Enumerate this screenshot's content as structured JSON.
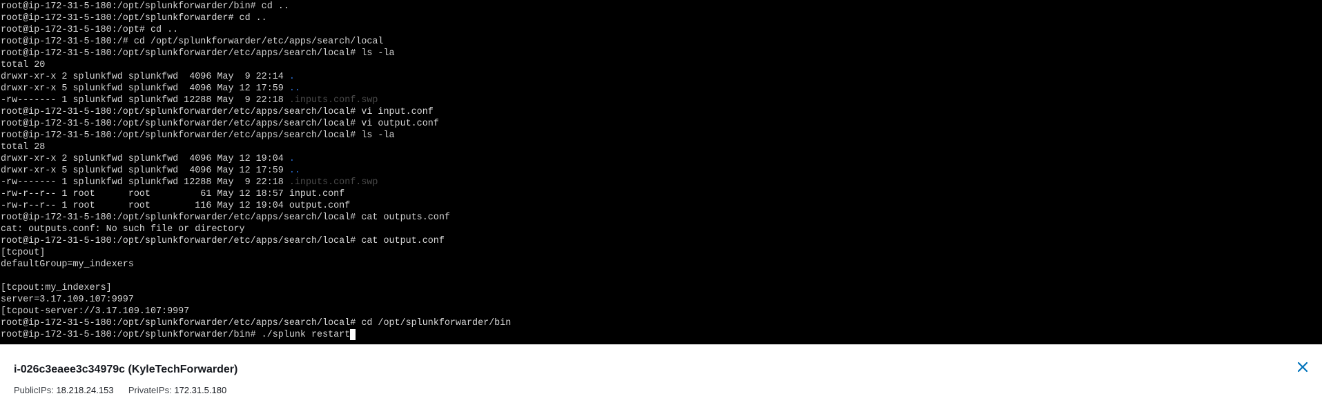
{
  "terminal": {
    "lines": [
      [
        {
          "t": "root@ip-172-31-5-180:/opt/splunkforwarder/bin# cd .."
        }
      ],
      [
        {
          "t": "root@ip-172-31-5-180:/opt/splunkforwarder# cd .."
        }
      ],
      [
        {
          "t": "root@ip-172-31-5-180:/opt# cd .."
        }
      ],
      [
        {
          "t": "root@ip-172-31-5-180:/# cd /opt/splunkforwarder/etc/apps/search/local"
        }
      ],
      [
        {
          "t": "root@ip-172-31-5-180:/opt/splunkforwarder/etc/apps/search/local# ls -la"
        }
      ],
      [
        {
          "t": "total 20"
        }
      ],
      [
        {
          "t": "drwxr-xr-x 2 splunkfwd splunkfwd  4096 May  9 22:14 "
        },
        {
          "t": ".",
          "c": "blue"
        }
      ],
      [
        {
          "t": "drwxr-xr-x 5 splunkfwd splunkfwd  4096 May 12 17:59 "
        },
        {
          "t": "..",
          "c": "blue"
        }
      ],
      [
        {
          "t": "-rw------- 1 splunkfwd splunkfwd 12288 May  9 22:18 "
        },
        {
          "t": ".inputs.conf.swp",
          "c": "dim"
        }
      ],
      [
        {
          "t": "root@ip-172-31-5-180:/opt/splunkforwarder/etc/apps/search/local# vi input.conf"
        }
      ],
      [
        {
          "t": "root@ip-172-31-5-180:/opt/splunkforwarder/etc/apps/search/local# vi output.conf"
        }
      ],
      [
        {
          "t": "root@ip-172-31-5-180:/opt/splunkforwarder/etc/apps/search/local# ls -la"
        }
      ],
      [
        {
          "t": "total 28"
        }
      ],
      [
        {
          "t": "drwxr-xr-x 2 splunkfwd splunkfwd  4096 May 12 19:04 "
        },
        {
          "t": ".",
          "c": "blue"
        }
      ],
      [
        {
          "t": "drwxr-xr-x 5 splunkfwd splunkfwd  4096 May 12 17:59 "
        },
        {
          "t": "..",
          "c": "blue"
        }
      ],
      [
        {
          "t": "-rw------- 1 splunkfwd splunkfwd 12288 May  9 22:18 "
        },
        {
          "t": ".inputs.conf.swp",
          "c": "dim"
        }
      ],
      [
        {
          "t": "-rw-r--r-- 1 root      root         61 May 12 18:57 input.conf"
        }
      ],
      [
        {
          "t": "-rw-r--r-- 1 root      root        116 May 12 19:04 output.conf"
        }
      ],
      [
        {
          "t": "root@ip-172-31-5-180:/opt/splunkforwarder/etc/apps/search/local# cat outputs.conf"
        }
      ],
      [
        {
          "t": "cat: outputs.conf: No such file or directory"
        }
      ],
      [
        {
          "t": "root@ip-172-31-5-180:/opt/splunkforwarder/etc/apps/search/local# cat output.conf"
        }
      ],
      [
        {
          "t": "[tcpout]"
        }
      ],
      [
        {
          "t": "defaultGroup=my_indexers"
        }
      ],
      [
        {
          "t": ""
        }
      ],
      [
        {
          "t": "[tcpout:my_indexers]"
        }
      ],
      [
        {
          "t": "server=3.17.109.107:9997"
        }
      ],
      [
        {
          "t": "[tcpout-server://3.17.109.107:9997"
        }
      ],
      [
        {
          "t": "root@ip-172-31-5-180:/opt/splunkforwarder/etc/apps/search/local# cd /opt/splunkforwarder/bin"
        }
      ],
      [
        {
          "t": "root@ip-172-31-5-180:/opt/splunkforwarder/bin# ./splunk restart"
        }
      ]
    ],
    "colors": {
      "background": "#000000",
      "text": "#d6d6d6",
      "blue": "#2a6fd6",
      "dim": "#4a4a4a",
      "cursor": "#ffffff"
    }
  },
  "instance_panel": {
    "title": "i-026c3eaee3c34979c (KyleTechForwarder)",
    "public_ips_label": "PublicIPs:",
    "public_ips_value": "18.218.24.153",
    "private_ips_label": "PrivateIPs:",
    "private_ips_value": "172.31.5.180",
    "close_icon": "close-icon",
    "accent_color": "#0073bb"
  }
}
